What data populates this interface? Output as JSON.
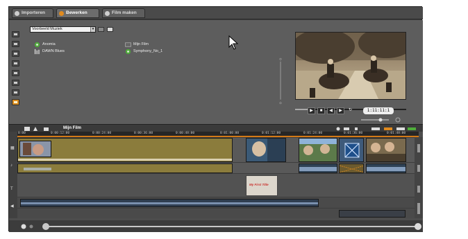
{
  "tabs": [
    {
      "label": "Importeren",
      "icon": "import-icon"
    },
    {
      "label": "Bewerken",
      "icon": "edit-icon"
    },
    {
      "label": "Film maken",
      "icon": "movie-icon"
    }
  ],
  "library": {
    "selector_value": "Voorbeeld Muziek",
    "items": [
      {
        "label": "Anomia",
        "icon": "music-icon"
      },
      {
        "label": "Mijn Film",
        "icon": "project-icon"
      },
      {
        "label": "DAWN Blues",
        "icon": "midi-icon"
      },
      {
        "label": "Symphony_No_1",
        "icon": "music-icon"
      }
    ]
  },
  "player": {
    "timecode": "1:11:11:1",
    "buttons": [
      "play",
      "stop",
      "rewind",
      "forward",
      "loop"
    ]
  },
  "timeline": {
    "project_title": "Mijn Film",
    "ruler_ticks": [
      "0:00",
      "0:00:12:00",
      "0:00:24:00",
      "0:00:36:00",
      "0:00:48:00",
      "0:01:00:00",
      "0:01:12:00",
      "0:01:24:00",
      "0:01:36:00",
      "0:01:48:00"
    ],
    "title_clip_text": "My First Title"
  },
  "colors": {
    "accent": "#d47a16",
    "olive_clip": "#8b7c3c",
    "audio_wave": "#9ab4d6"
  }
}
